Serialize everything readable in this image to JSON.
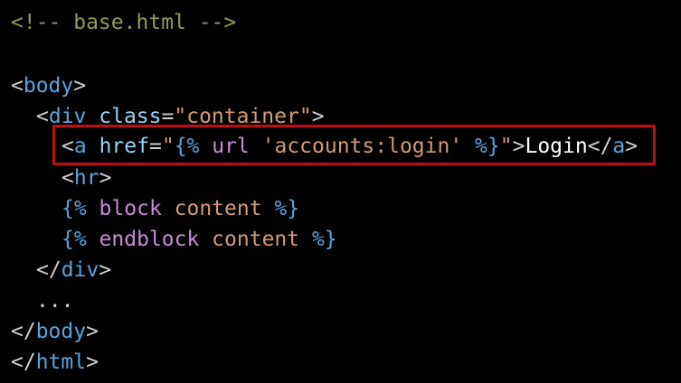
{
  "colors": {
    "background": "#000000",
    "comment": "#8f9b57",
    "tag": "#5aa3de",
    "attribute": "#9ad1f3",
    "string": "#d39a74",
    "template_keyword": "#c98bd8",
    "plain_text": "#ffffff",
    "highlight_border": "#c00d0d"
  },
  "code": {
    "line1": {
      "comment": "<!-- base.html -->"
    },
    "line3": {
      "open": "<",
      "tag": "body",
      "close": ">"
    },
    "line4": {
      "open": "<",
      "tag": "div",
      "space": " ",
      "attr": "class",
      "eq": "=",
      "value": "\"container\"",
      "close": ">"
    },
    "line5": {
      "open": "<",
      "tag": "a",
      "space": " ",
      "attr": "href",
      "eq": "=",
      "quote_open": "\"",
      "tpl_open": "{%",
      "keyword": " url ",
      "arg": "'accounts:login'",
      "tpl_close": " %}",
      "quote_close": "\"",
      "close": ">",
      "text": "Login",
      "end_open": "</",
      "end_tag": "a",
      "end_close": ">"
    },
    "line6": {
      "open": "<",
      "tag": "hr",
      "close": ">"
    },
    "line7": {
      "tpl_open": "{%",
      "keyword": " block",
      "arg": " content",
      "tpl_close": " %}"
    },
    "line8": {
      "tpl_open": "{%",
      "keyword": " endblock",
      "arg": " content",
      "tpl_close": " %}"
    },
    "line9": {
      "open": "</",
      "tag": "div",
      "close": ">"
    },
    "line10": {
      "ellipsis": "..."
    },
    "line11": {
      "open": "</",
      "tag": "body",
      "close": ">"
    },
    "line12": {
      "open": "</",
      "tag": "html",
      "close": ">"
    }
  }
}
